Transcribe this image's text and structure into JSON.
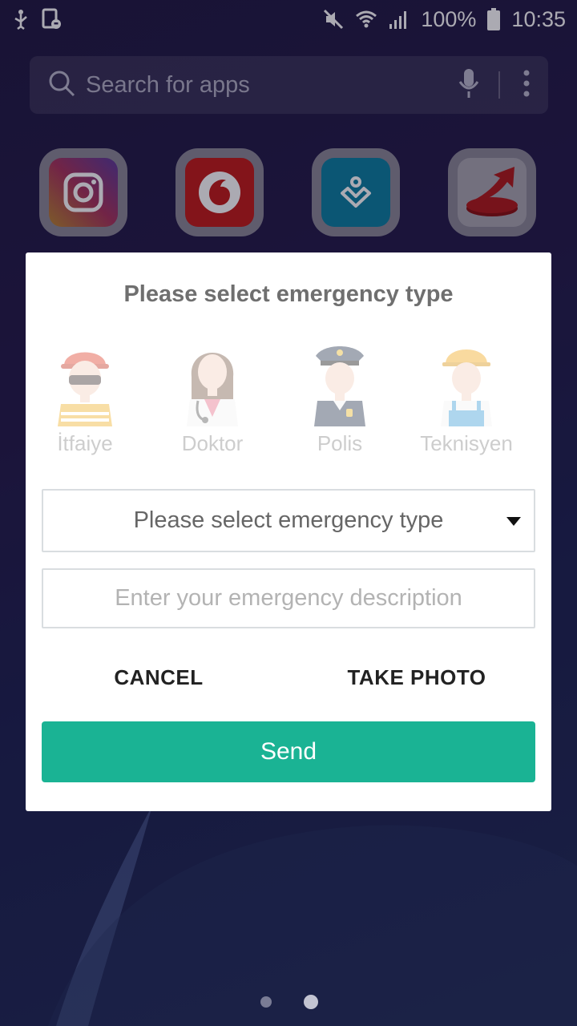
{
  "status_bar": {
    "battery_percent": "100%",
    "time": "10:35"
  },
  "search": {
    "placeholder": "Search for apps"
  },
  "apps": [
    {
      "icon": "instagram-icon"
    },
    {
      "icon": "vodafone-icon"
    },
    {
      "icon": "health-app-icon"
    },
    {
      "icon": "start-arrow-icon"
    }
  ],
  "dialog": {
    "title": "Please select emergency type",
    "types": [
      {
        "label": "İtfaiye",
        "icon": "firefighter-icon"
      },
      {
        "label": "Doktor",
        "icon": "doctor-icon"
      },
      {
        "label": "Polis",
        "icon": "police-icon"
      },
      {
        "label": "Teknisyen",
        "icon": "technician-icon"
      }
    ],
    "select_value": "Please select emergency type",
    "description_placeholder": "Enter your emergency description",
    "description_value": "",
    "cancel_label": "CANCEL",
    "take_photo_label": "TAKE PHOTO",
    "send_label": "Send"
  },
  "colors": {
    "send_button": "#1ab394"
  },
  "pager": {
    "page_count": 2,
    "active_page": 2
  }
}
